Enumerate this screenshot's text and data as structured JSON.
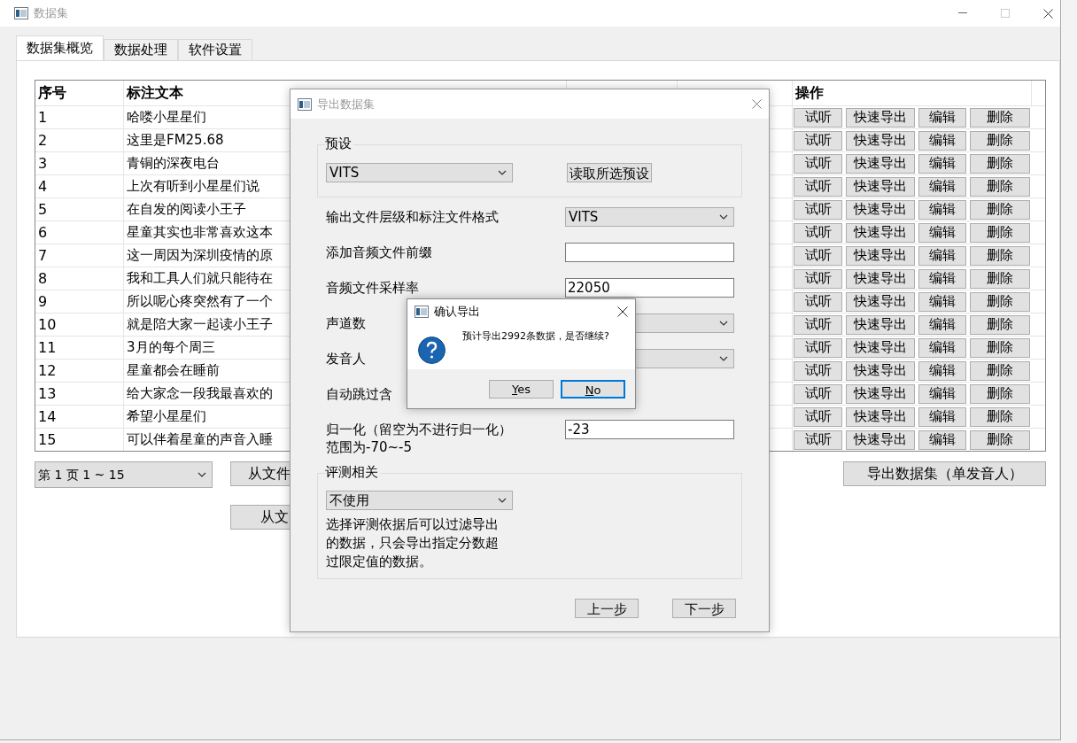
{
  "window": {
    "title": "数据集"
  },
  "tabs": [
    {
      "label": "数据集概览",
      "selected": true
    },
    {
      "label": "数据处理",
      "selected": false
    },
    {
      "label": "软件设置",
      "selected": false
    }
  ],
  "table": {
    "columns": [
      "序号",
      "标注文本",
      "操作"
    ],
    "rows": [
      {
        "index": "1",
        "text": "哈喽小星星们",
        "actions": [
          "试听",
          "快速导出",
          "编辑",
          "删除"
        ]
      },
      {
        "index": "2",
        "text": "这里是FM25.68",
        "actions": [
          "试听",
          "快速导出",
          "编辑",
          "删除"
        ]
      },
      {
        "index": "3",
        "text": "青铜的深夜电台",
        "actions": [
          "试听",
          "快速导出",
          "编辑",
          "删除"
        ]
      },
      {
        "index": "4",
        "text": "上次有听到小星星们说",
        "actions": [
          "试听",
          "快速导出",
          "编辑",
          "删除"
        ]
      },
      {
        "index": "5",
        "text": "在自发的阅读小王子",
        "actions": [
          "试听",
          "快速导出",
          "编辑",
          "删除"
        ]
      },
      {
        "index": "6",
        "text": "星童其实也非常喜欢这本",
        "actions": [
          "试听",
          "快速导出",
          "编辑",
          "删除"
        ]
      },
      {
        "index": "7",
        "text": "这一周因为深圳疫情的原",
        "actions": [
          "试听",
          "快速导出",
          "编辑",
          "删除"
        ]
      },
      {
        "index": "8",
        "text": "我和工具人们就只能待在",
        "actions": [
          "试听",
          "快速导出",
          "编辑",
          "删除"
        ]
      },
      {
        "index": "9",
        "text": "所以呢心疼突然有了一个",
        "actions": [
          "试听",
          "快速导出",
          "编辑",
          "删除"
        ]
      },
      {
        "index": "10",
        "text": "就是陪大家一起读小王子",
        "actions": [
          "试听",
          "快速导出",
          "编辑",
          "删除"
        ]
      },
      {
        "index": "11",
        "text": "3月的每个周三",
        "actions": [
          "试听",
          "快速导出",
          "编辑",
          "删除"
        ]
      },
      {
        "index": "12",
        "text": "星童都会在睡前",
        "actions": [
          "试听",
          "快速导出",
          "编辑",
          "删除"
        ]
      },
      {
        "index": "13",
        "text": "给大家念一段我最喜欢的",
        "actions": [
          "试听",
          "快速导出",
          "编辑",
          "删除"
        ]
      },
      {
        "index": "14",
        "text": "希望小星星们",
        "actions": [
          "试听",
          "快速导出",
          "编辑",
          "删除"
        ]
      },
      {
        "index": "15",
        "text": "可以伴着星童的声音入睡",
        "actions": [
          "试听",
          "快速导出",
          "编辑",
          "删除"
        ]
      }
    ]
  },
  "page_select": {
    "value": "第 1 页  1 ~ 15"
  },
  "file_buttons": [
    "从文件",
    "从文"
  ],
  "export_button": "导出数据集（单发音人）",
  "export_dialog": {
    "title": "导出数据集",
    "preset": {
      "title": "预设",
      "value": "VITS",
      "button": "读取所选预设"
    },
    "fields": [
      {
        "kind": "combo",
        "label": "输出文件层级和标注文件格式",
        "value": "VITS"
      },
      {
        "kind": "input",
        "label": "添加音频文件前缀"
      },
      {
        "kind": "input",
        "label": "音频文件采样率",
        "value": "22050"
      },
      {
        "kind": "combo",
        "label": "声道数"
      },
      {
        "kind": "combo",
        "label": "发音人"
      },
      {
        "kind": "plain",
        "label": "自动跳过含"
      },
      {
        "kind": "input",
        "label": "归一化（留空为不进行归一化）",
        "note": "范围为-70~-5",
        "value": "-23"
      }
    ],
    "eval": {
      "title": "评测相关",
      "value": "不使用",
      "description": "选择评测依据后可以过滤导出的数据，只会导出指定分数超过限定值的数据。"
    },
    "buttons": [
      "上一步",
      "下一步"
    ]
  },
  "confirm_dialog": {
    "title": "确认导出",
    "message": "预计导出2992条数据，是否继续?",
    "buttons": [
      {
        "label": "Yes",
        "focused": false
      },
      {
        "label": "No",
        "focused": true
      }
    ]
  }
}
